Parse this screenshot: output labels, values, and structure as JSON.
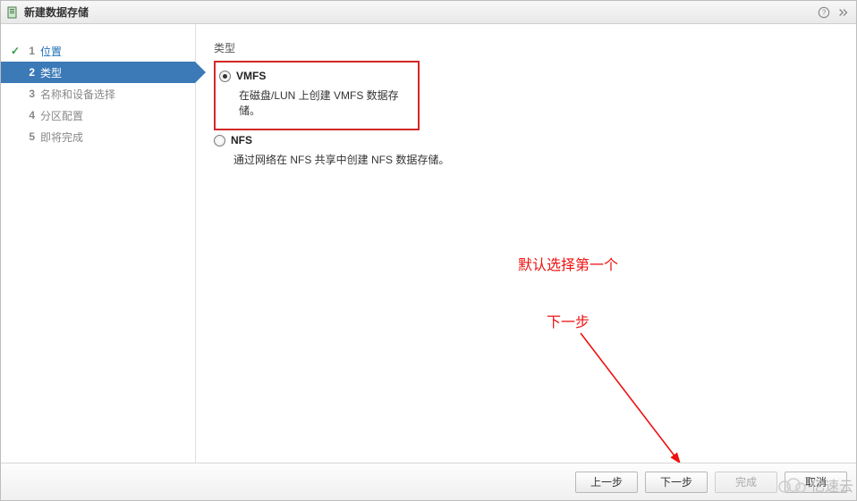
{
  "header": {
    "title": "新建数据存储"
  },
  "sidebar": {
    "steps": [
      {
        "num": "1",
        "label": "位置"
      },
      {
        "num": "2",
        "label": "类型"
      },
      {
        "num": "3",
        "label": "名称和设备选择"
      },
      {
        "num": "4",
        "label": "分区配置"
      },
      {
        "num": "5",
        "label": "即将完成"
      }
    ]
  },
  "main": {
    "section_label": "类型",
    "option_vmfs": {
      "label": "VMFS",
      "desc": "在磁盘/LUN 上创建 VMFS 数据存储。"
    },
    "option_nfs": {
      "label": "NFS",
      "desc": "通过网络在 NFS 共享中创建 NFS 数据存储。"
    }
  },
  "annotations": {
    "note1": "默认选择第一个",
    "note2": "下一步"
  },
  "footer": {
    "back": "上一步",
    "next": "下一步",
    "finish": "完成",
    "cancel": "取消"
  },
  "watermark": "亿速云"
}
